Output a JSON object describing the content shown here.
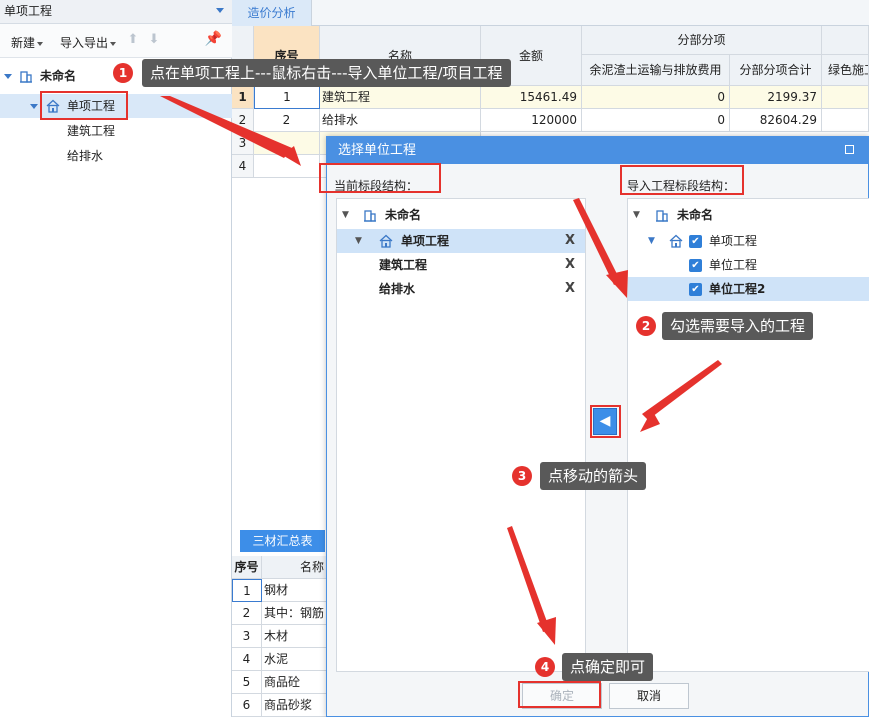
{
  "left_panel": {
    "title": "单项工程",
    "toolbar": {
      "new_label": "新建",
      "import_export_label": "导入导出"
    },
    "tree": {
      "root": "未命名",
      "single_project": "单项工程",
      "children": [
        "建筑工程",
        "给排水"
      ]
    }
  },
  "tabs": {
    "cost_analysis": "造价分析"
  },
  "grid": {
    "headers": {
      "seq": "序号",
      "name": "名称",
      "amount": "金额",
      "group": "分部分项",
      "sub1": "余泥渣土运输与排放费用",
      "sub2": "分部分项合计",
      "sub3": "绿色施工"
    },
    "rows": [
      {
        "row": "1",
        "seq": "1",
        "name": "建筑工程",
        "amount": "15461.49",
        "c1": "0",
        "c2": "2199.37"
      },
      {
        "row": "2",
        "seq": "2",
        "name": "给排水",
        "amount": "120000",
        "c1": "0",
        "c2": "82604.29"
      },
      {
        "row": "3",
        "seq": "",
        "name": "",
        "amount": "",
        "c1": "",
        "c2": ""
      },
      {
        "row": "4",
        "seq": "",
        "name": "",
        "amount": "",
        "c1": "",
        "c2": ""
      }
    ]
  },
  "lower": {
    "button": "三材汇总表",
    "headers": {
      "seq": "序号",
      "name": "名称"
    },
    "rows": [
      {
        "seq": "1",
        "name": "钢材"
      },
      {
        "seq": "2",
        "name": "其中：钢筋"
      },
      {
        "seq": "3",
        "name": "木材"
      },
      {
        "seq": "4",
        "name": "水泥"
      },
      {
        "seq": "5",
        "name": "商品砼"
      },
      {
        "seq": "6",
        "name": "商品砂浆"
      }
    ]
  },
  "dialog": {
    "title": "选择单位工程",
    "current_label": "当前标段结构：",
    "import_label": "导入工程标段结构：",
    "current_tree": {
      "root": "未命名",
      "single": "单项工程",
      "children": [
        "建筑工程",
        "给排水"
      ],
      "x": "X"
    },
    "import_tree": {
      "root": "未命名",
      "single": "单项工程",
      "children": [
        "单位工程",
        "单位工程2"
      ]
    },
    "move_arrow": "◀",
    "ok_label": "确定",
    "cancel_label": "取消"
  },
  "annotations": [
    {
      "num": "1",
      "text": "点在单项工程上---鼠标右击---导入单位工程/项目工程"
    },
    {
      "num": "2",
      "text": "勾选需要导入的工程"
    },
    {
      "num": "3",
      "text": "点移动的箭头"
    },
    {
      "num": "4",
      "text": "点确定即可"
    }
  ],
  "colors": {
    "accent": "#4a90e2",
    "annotation_red": "#e5322d",
    "selected_row": "#cfe3f8"
  }
}
